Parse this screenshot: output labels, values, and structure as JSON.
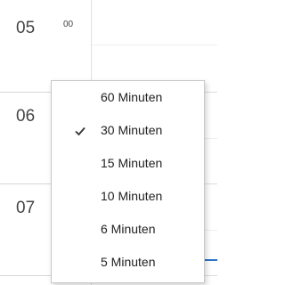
{
  "timeline": {
    "hours": [
      "05",
      "06",
      "07"
    ],
    "minute_label": "00"
  },
  "interval_menu": {
    "selected": "30 Minuten",
    "check_icon": "checkmark-icon",
    "items": [
      {
        "label": "60 Minuten",
        "checked": false
      },
      {
        "label": "30 Minuten",
        "checked": true
      },
      {
        "label": "15 Minuten",
        "checked": false
      },
      {
        "label": "10 Minuten",
        "checked": false
      },
      {
        "label": "6 Minuten",
        "checked": false
      },
      {
        "label": "5 Minuten",
        "checked": false
      }
    ]
  },
  "colors": {
    "current_time_indicator": "#2b74c8"
  }
}
